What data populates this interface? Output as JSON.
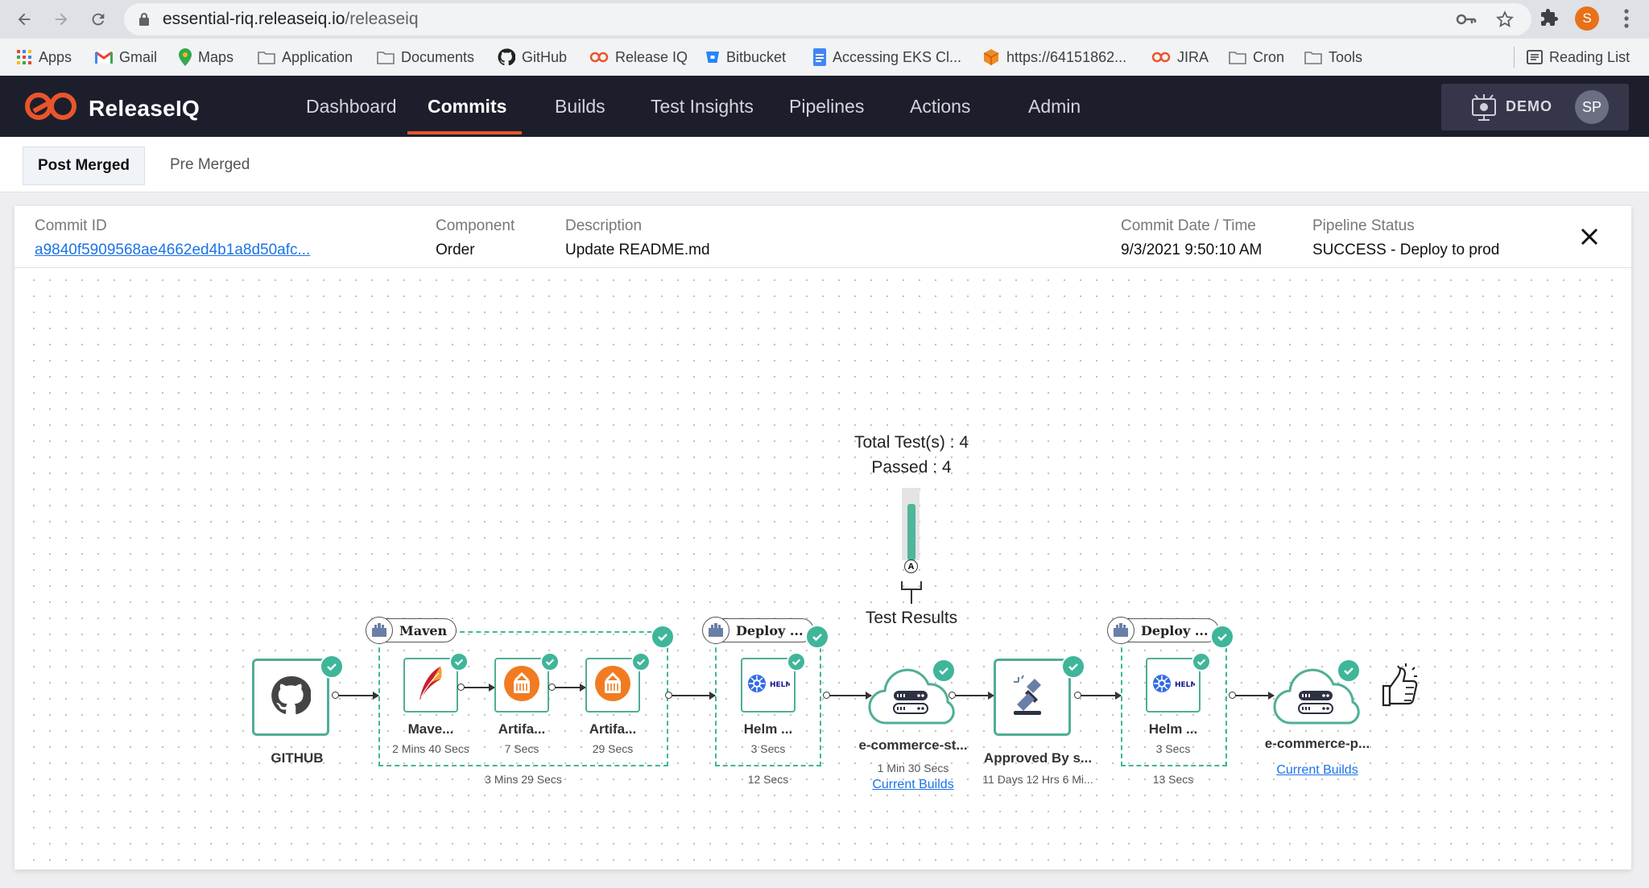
{
  "browser": {
    "url_host": "essential-riq.releaseiq.io",
    "url_path": "/releaseiq",
    "profile_initial": "S",
    "bookmarks": [
      "Apps",
      "Gmail",
      "Maps",
      "Application",
      "Documents",
      "GitHub",
      "Release IQ",
      "Bitbucket",
      "Accessing EKS Cl...",
      "https://64151862...",
      "JIRA",
      "Cron",
      "Tools"
    ],
    "reading_list": "Reading List"
  },
  "app": {
    "name": "ReleaseIQ",
    "nav": [
      "Dashboard",
      "Commits",
      "Builds",
      "Test Insights",
      "Pipelines",
      "Actions",
      "Admin"
    ],
    "active_nav": "Commits",
    "account_label": "DEMO",
    "avatar_initials": "SP",
    "brand_color": "#e9552b"
  },
  "subtabs": {
    "post_merged": "Post Merged",
    "pre_merged": "Pre Merged"
  },
  "commit": {
    "commit_id_label": "Commit ID",
    "commit_id": "a9840f5909568ae4662ed4b1a8d50afc...",
    "component_label": "Component",
    "component": "Order",
    "description_label": "Description",
    "description": "Update README.md",
    "date_label": "Commit Date / Time",
    "date": "9/3/2021 9:50:10 AM",
    "status_label": "Pipeline Status",
    "status": "SUCCESS - Deploy to prod"
  },
  "tests": {
    "total": "Total Test(s) : 4",
    "passed": "Passed : 4",
    "marker": "A",
    "label": "Test Results",
    "pass_fraction": 1.0
  },
  "pipeline": {
    "source": {
      "label": "GITHUB"
    },
    "build_group": {
      "title": "Maven",
      "total": "3 Mins 29 Secs",
      "steps": [
        {
          "label": "Mave...",
          "duration": "2 Mins 40 Secs",
          "icon": "maven-feather-icon"
        },
        {
          "label": "Artifa...",
          "duration": "7 Secs",
          "icon": "artifactory-icon"
        },
        {
          "label": "Artifa...",
          "duration": "29 Secs",
          "icon": "artifactory-icon"
        }
      ]
    },
    "deploy_stage": {
      "title": "Deploy ...",
      "total": "12 Secs",
      "step": {
        "label": "Helm ...",
        "duration": "3 Secs",
        "icon": "helm-icon"
      }
    },
    "staging_env": {
      "label": "e-commerce-st...",
      "duration": "1 Min 30 Secs",
      "link": "Current Builds"
    },
    "approval": {
      "label": "Approved By s...",
      "duration": "11 Days 12 Hrs 6 Mi..."
    },
    "deploy_prod": {
      "title": "Deploy ...",
      "total": "13 Secs",
      "step": {
        "label": "Helm ...",
        "duration": "3 Secs",
        "icon": "helm-icon"
      }
    },
    "prod_env": {
      "label": "e-commerce-p...",
      "link": "Current Builds"
    },
    "success_color": "#3fb59a"
  }
}
